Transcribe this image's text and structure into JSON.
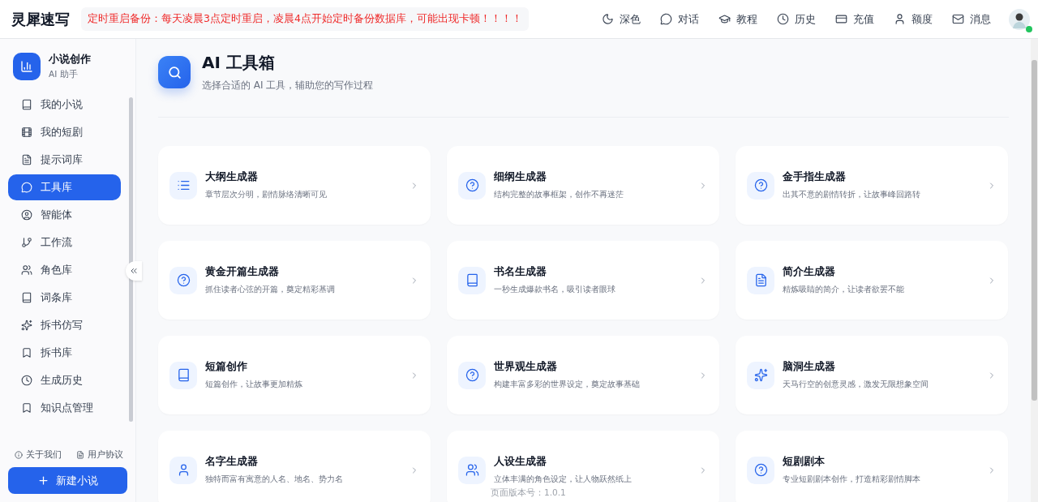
{
  "header": {
    "logo": "灵犀速写",
    "notice": "定时重启备份：每天凌晨3点定时重启，凌晨4点开始定时备份数据库，可能出现卡顿！！！！",
    "nav": [
      {
        "label": "深色"
      },
      {
        "label": "对话"
      },
      {
        "label": "教程"
      },
      {
        "label": "历史"
      },
      {
        "label": "充值"
      },
      {
        "label": "额度"
      },
      {
        "label": "消息"
      }
    ],
    "user": {
      "online": true
    }
  },
  "sidebar": {
    "brand": {
      "title": "小说创作",
      "subtitle": "AI 助手"
    },
    "items": [
      {
        "label": "我的小说",
        "selected": false
      },
      {
        "label": "我的短剧",
        "selected": false
      },
      {
        "label": "提示词库",
        "selected": false
      },
      {
        "label": "工具库",
        "selected": true
      },
      {
        "label": "智能体",
        "selected": false
      },
      {
        "label": "工作流",
        "selected": false
      },
      {
        "label": "角色库",
        "selected": false
      },
      {
        "label": "词条库",
        "selected": false
      },
      {
        "label": "拆书仿写",
        "selected": false
      },
      {
        "label": "拆书库",
        "selected": false
      },
      {
        "label": "生成历史",
        "selected": false
      },
      {
        "label": "知识点管理",
        "selected": false
      }
    ],
    "links": [
      "关于我们",
      "用户协议"
    ],
    "new_button": "新建小说"
  },
  "page": {
    "title": "AI 工具箱",
    "subtitle": "选择合适的 AI 工具，辅助您的写作过程",
    "tools": [
      {
        "name": "大纲生成器",
        "desc": "章节层次分明，剧情脉络清晰可见"
      },
      {
        "name": "细纲生成器",
        "desc": "结构完整的故事框架，创作不再迷茫"
      },
      {
        "name": "金手指生成器",
        "desc": "出其不意的剧情转折，让故事峰回路转"
      },
      {
        "name": "黄金开篇生成器",
        "desc": "抓住读者心弦的开篇，奠定精彩基调"
      },
      {
        "name": "书名生成器",
        "desc": "一秒生成爆款书名，吸引读者眼球"
      },
      {
        "name": "简介生成器",
        "desc": "精炼吸睛的简介，让读者欲罢不能"
      },
      {
        "name": "短篇创作",
        "desc": "短篇创作，让故事更加精炼"
      },
      {
        "name": "世界观生成器",
        "desc": "构建丰富多彩的世界设定，奠定故事基础"
      },
      {
        "name": "脑洞生成器",
        "desc": "天马行空的创意灵感，激发无限想象空间"
      },
      {
        "name": "名字生成器",
        "desc": "独特而富有寓意的人名、地名、势力名"
      },
      {
        "name": "人设生成器",
        "desc": "立体丰满的角色设定，让人物跃然纸上"
      },
      {
        "name": "短剧剧本",
        "desc": "专业短剧剧本创作，打造精彩剧情脚本"
      }
    ],
    "version": "页面版本号：1.0.1"
  }
}
